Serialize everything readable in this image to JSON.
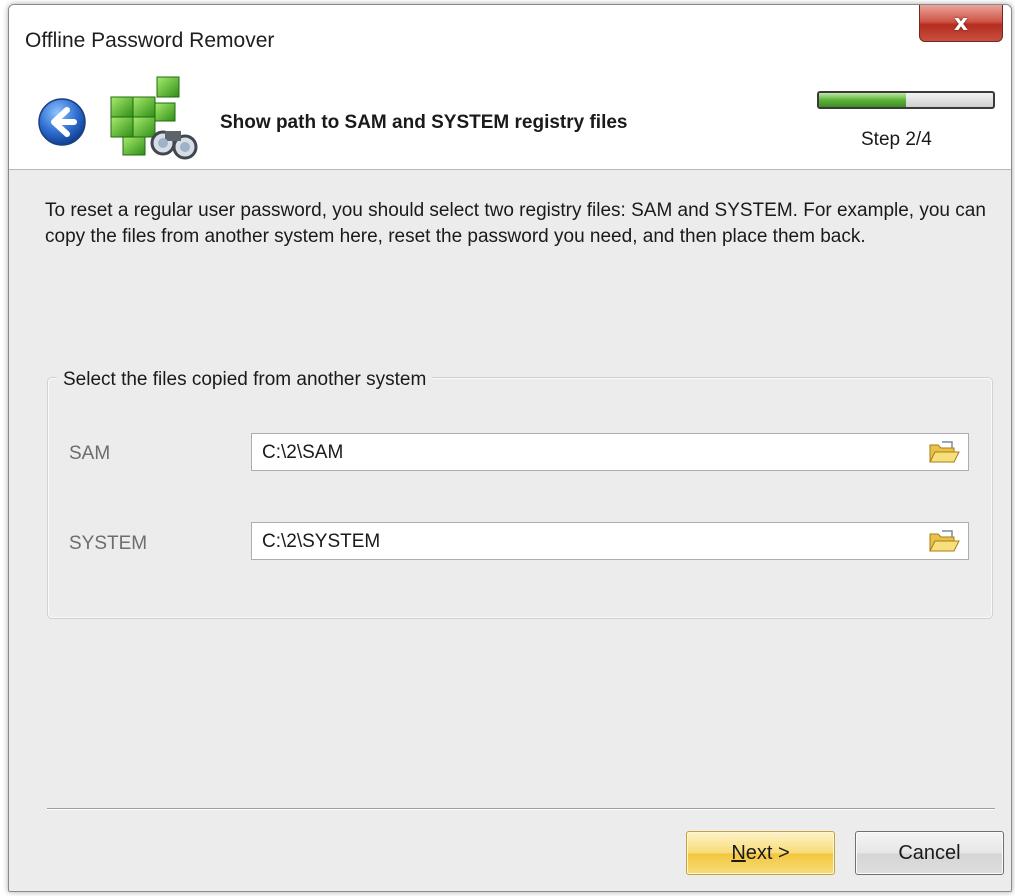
{
  "window": {
    "title": "Offline Password Remover",
    "close_label": "x"
  },
  "header": {
    "title": "Show path to SAM and SYSTEM registry files",
    "step_label": "Step 2/4",
    "progress_fraction": 0.5
  },
  "main": {
    "description": "To reset a regular user password, you should select two registry files: SAM and SYSTEM. For example, you can copy the files from another system here, reset the password you need, and then place them back.",
    "group": {
      "legend": "Select the files copied from another system",
      "fields": [
        {
          "label": "SAM",
          "value": "C:\\2\\SAM",
          "browse_icon": "folder-open-icon"
        },
        {
          "label": "SYSTEM",
          "value": "C:\\2\\SYSTEM",
          "browse_icon": "folder-open-icon"
        }
      ]
    }
  },
  "footer": {
    "next_hotkey": "N",
    "next_rest": "ext >",
    "cancel_label": "Cancel"
  },
  "colors": {
    "accent_green": "#5db33a",
    "close_red": "#c8503f",
    "next_button_yellow": "#f8dc79"
  }
}
